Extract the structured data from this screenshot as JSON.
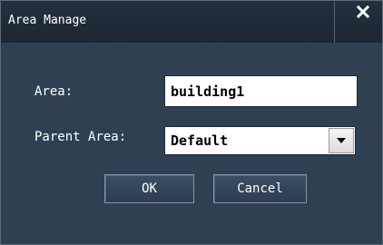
{
  "dialog": {
    "title": "Area Manage",
    "close_label": "X"
  },
  "form": {
    "area_label": "Area:",
    "area_value": "building1",
    "parent_label": "Parent Area:",
    "parent_value": "Default"
  },
  "buttons": {
    "ok_label": "OK",
    "cancel_label": "Cancel"
  },
  "colors": {
    "dialog_background": "#2f4053",
    "titlebar_background": "#1c2733",
    "text": "#ffffff"
  },
  "icons": {
    "close": "close-icon",
    "dropdown": "triangle-down-icon"
  }
}
